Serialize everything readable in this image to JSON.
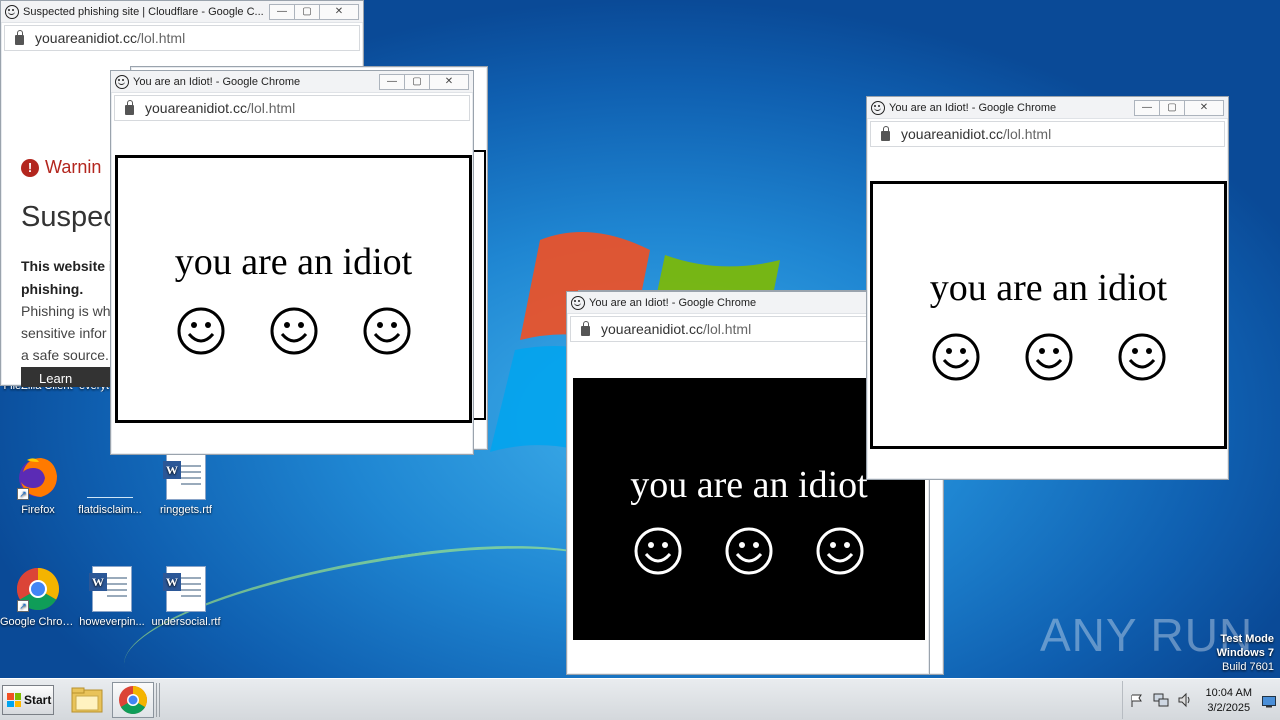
{
  "desktop": {
    "icons": [
      {
        "label": "FileZilla Client"
      },
      {
        "label": "everyt"
      },
      {
        "label": "Firefox"
      },
      {
        "label": "flatdisclaim..."
      },
      {
        "label": "ringgets.rtf"
      },
      {
        "label": "Google Chrome"
      },
      {
        "label": "howeverpin..."
      },
      {
        "label": "undersocial.rtf"
      }
    ],
    "watermark": "ANY RUN",
    "test_mode": {
      "line1": "Test Mode",
      "line2": "Windows 7",
      "line3": "Build 7601"
    }
  },
  "windows": {
    "cloudflare": {
      "title": "Suspected phishing site | Cloudflare - Google C...",
      "url_host": "youareanidiot.cc",
      "url_path": "/lol.html",
      "warning": "Warnin",
      "heading": "Suspec",
      "bold_text_1": "This website i",
      "bold_text_2": "phishing.",
      "body_1": "Phishing is wh",
      "body_2": "sensitive infor",
      "body_3": "a safe source.",
      "button": "Learn More"
    },
    "idiot_1": {
      "title": "You are an Idiot! - Google Chrome",
      "url_host": "youareanidiot.cc",
      "url_path": "/lol.html",
      "text": "you are an idiot"
    },
    "idiot_2": {
      "title": "You are an Idiot! - Google Chrome",
      "url_host": "youareanidiot.cc",
      "url_path": "/lol.html",
      "text": "you are an idiot"
    },
    "idiot_3": {
      "title": "You are an Idiot! - Google Chrome",
      "url_host": "youareanidiot.cc",
      "url_path": "/lol.html",
      "text": "you are an idiot"
    }
  },
  "window_controls": {
    "minimize": "—",
    "maximize": "▢",
    "close": "✕"
  },
  "taskbar": {
    "start_label": "Start",
    "clock_time": "10:04 AM",
    "clock_date": "3/2/2025"
  },
  "colors": {
    "warning_red": "#b3261e",
    "title_bar": "#f2f3f5",
    "desktop_blue": "#1f86d2"
  }
}
